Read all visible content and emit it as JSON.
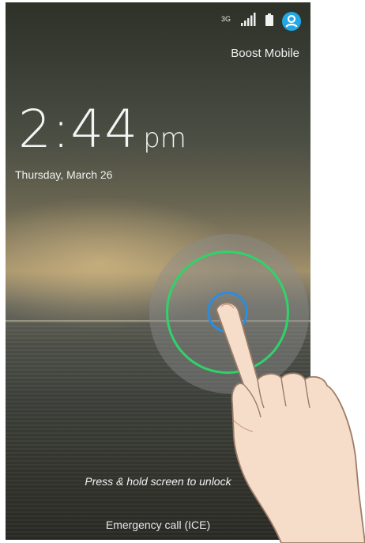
{
  "status_bar": {
    "network": "3G",
    "icons": [
      "signal-icon",
      "battery-icon",
      "user-icon"
    ],
    "accent_color": "#22a8e6"
  },
  "carrier": "Boost Mobile",
  "clock": {
    "time": "2:44",
    "ampm": "pm"
  },
  "date": "Thursday, March 26",
  "unlock": {
    "hint": "Press & hold screen to unlock",
    "ring_color": "#30d36a",
    "touch_color": "#2a8de0"
  },
  "bottom": {
    "emergency_label": "Emergency call (ICE)",
    "camera_icon": "camera-icon"
  }
}
